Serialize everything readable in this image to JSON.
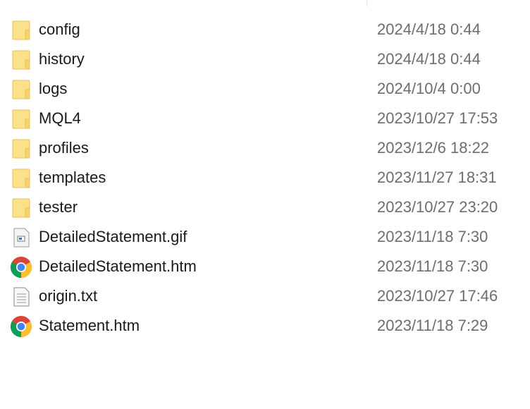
{
  "files": [
    {
      "name": "config",
      "date": "2024/4/18 0:44",
      "icon": "folder-icon"
    },
    {
      "name": "history",
      "date": "2024/4/18 0:44",
      "icon": "folder-icon"
    },
    {
      "name": "logs",
      "date": "2024/10/4 0:00",
      "icon": "folder-icon"
    },
    {
      "name": "MQL4",
      "date": "2023/10/27 17:53",
      "icon": "folder-icon"
    },
    {
      "name": "profiles",
      "date": "2023/12/6 18:22",
      "icon": "folder-icon"
    },
    {
      "name": "templates",
      "date": "2023/11/27 18:31",
      "icon": "folder-icon"
    },
    {
      "name": "tester",
      "date": "2023/10/27 23:20",
      "icon": "folder-icon"
    },
    {
      "name": "DetailedStatement.gif",
      "date": "2023/11/18 7:30",
      "icon": "image-file-icon"
    },
    {
      "name": "DetailedStatement.htm",
      "date": "2023/11/18 7:30",
      "icon": "chrome-icon"
    },
    {
      "name": "origin.txt",
      "date": "2023/10/27 17:46",
      "icon": "text-file-icon"
    },
    {
      "name": "Statement.htm",
      "date": "2023/11/18 7:29",
      "icon": "chrome-icon"
    }
  ]
}
